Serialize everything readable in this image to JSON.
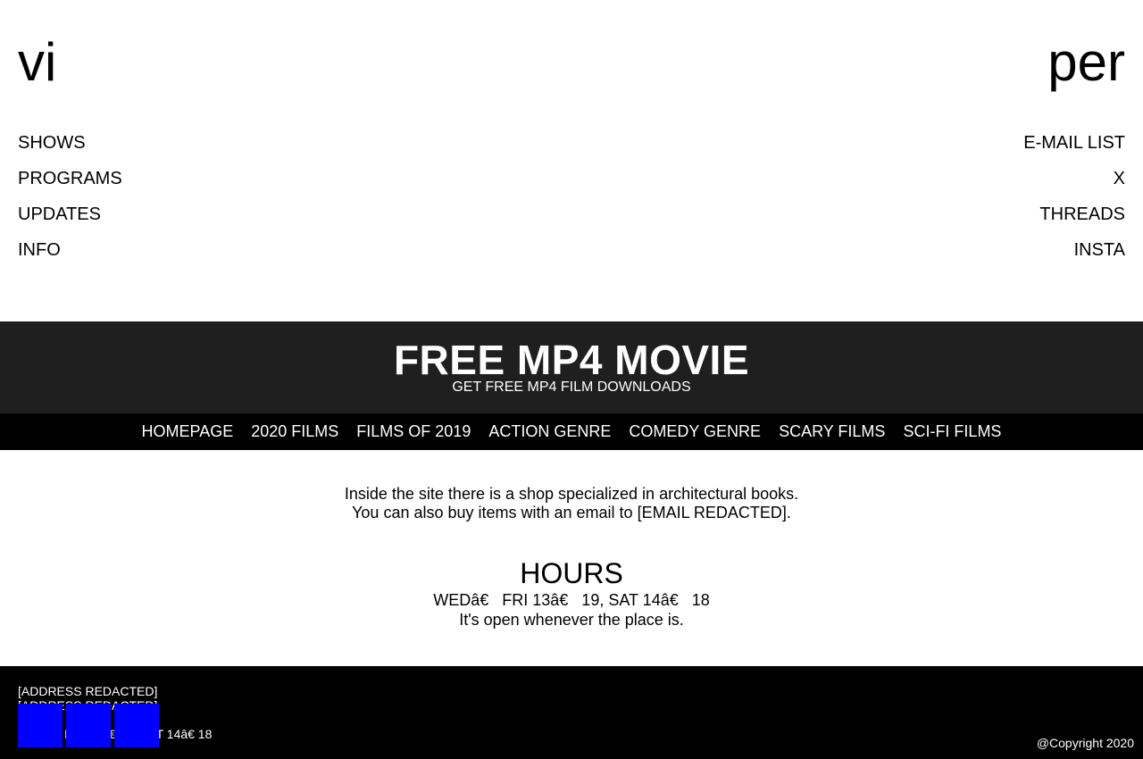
{
  "logo": {
    "left": "vi",
    "right": "per"
  },
  "nav_left": [
    "SHOWS",
    "PROGRAMS",
    "UPDATES",
    "INFO"
  ],
  "nav_right": [
    "E-MAIL LIST",
    "X",
    "THREADS",
    "INSTA"
  ],
  "banner": {
    "title": "FREE MP4 MOVIE",
    "subtitle": "GET FREE MP4 FILM DOWNLOADS"
  },
  "menu": [
    "HOMEPAGE",
    "2020 FILMS",
    "FILMS OF 2019",
    "ACTION GENRE",
    "COMEDY GENRE",
    "SCARY FILMS",
    "SCI-FI FILMS"
  ],
  "intro": {
    "line1": "Inside the site there is a shop specialized in architectural books.",
    "line2": "You can also buy items with an email to [EMAIL REDACTED]."
  },
  "hours": {
    "title": "HOURS",
    "schedule": "WEDâ€   FRI 13â€   19, SAT 14â€   18",
    "note": "It's open whenever the place is."
  },
  "footer": {
    "address_1": "[ADDRESS REDACTED]",
    "address_2": "[ADDRESS REDACTED]",
    "hours_partial": "WEDâ€ FRI 13â€ 19, SAT 14â€ 18",
    "copyright": "@Copyright 2020"
  },
  "colors": {
    "banner_bg": "#1f1f1f",
    "menu_bg": "#000000",
    "footer_bg": "#000000",
    "social_button": "#0000ff"
  }
}
